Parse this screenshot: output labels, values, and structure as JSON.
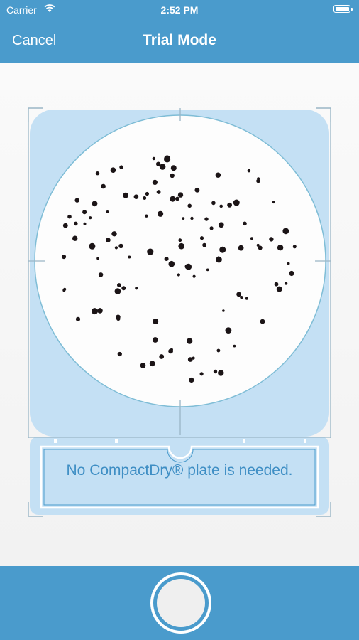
{
  "status_bar": {
    "carrier": "Carrier",
    "time": "2:52 PM",
    "icons": [
      "wifi-icon",
      "battery-icon"
    ]
  },
  "nav": {
    "cancel_label": "Cancel",
    "title": "Trial Mode"
  },
  "plate": {
    "message": "No CompactDry® plate is needed."
  },
  "capture": {
    "icon": "shutter-button"
  },
  "colors": {
    "bar_blue": "#4a9bcc",
    "overlay_blue": "#c4e0f4",
    "text_blue": "#3e8ec4"
  }
}
